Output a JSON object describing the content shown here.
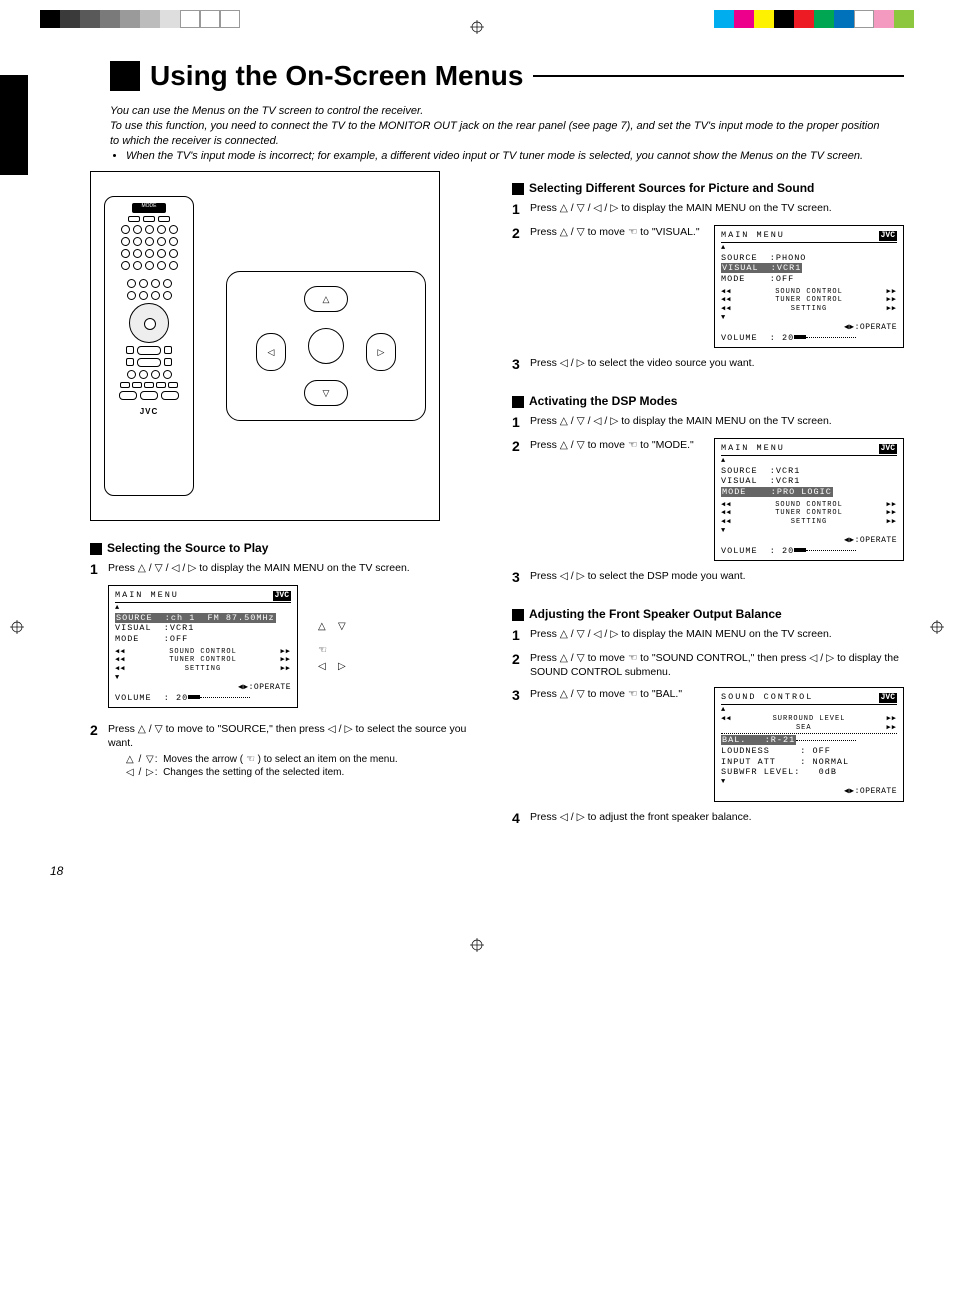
{
  "title": "Using the On-Screen Menus",
  "intro": {
    "p1": "You can use the Menus on the TV screen to control the receiver.",
    "p2": "To use this function, you need to connect the TV to the MONITOR OUT jack on the rear panel (see page 7), and set the TV's input mode to the proper position to which the receiver is connected.",
    "bullet": "When the TV's input mode is incorrect; for example, a different video input or TV tuner mode is selected, you cannot show the Menus on the TV screen."
  },
  "remote_brand": "JVC",
  "left": {
    "heading": "Selecting the Source to Play",
    "step1": {
      "text": "Press △ / ▽ / ◁ / ▷ to display the MAIN MENU on the TV screen."
    },
    "osd": {
      "title": "MAIN MENU",
      "brand": "JVC",
      "source": "SOURCE  :ch 1  FM 87.50MHz",
      "visual": "VISUAL  :VCR1",
      "mode": "MODE    :OFF",
      "l1": "SOUND CONTROL",
      "l2": "TUNER CONTROL",
      "l3": "SETTING",
      "operate": ":OPERATE",
      "volume": "VOLUME  : 20"
    },
    "step2": {
      "main": "Press △ / ▽ to move   to \"SOURCE,\" then press ◁ / ▷ to select the source you want.",
      "sub1": "△ / ▽:  Moves the arrow (  ) to select an item on the menu.",
      "sub2": "◁ / ▷:  Changes the setting of the selected item."
    }
  },
  "right": {
    "sec1": {
      "heading": "Selecting Different Sources for Picture and Sound",
      "step1": "Press △ / ▽ / ◁ / ▷ to display the MAIN MENU on the TV screen.",
      "step2": "Press △ / ▽ to move   to \"VISUAL.\"",
      "step3": "Press ◁ / ▷ to select the video source you want.",
      "osd": {
        "title": "MAIN MENU",
        "brand": "JVC",
        "source": "SOURCE  :PHONO",
        "visual": "VISUAL  :VCR1",
        "mode": "MODE    :OFF",
        "l1": "SOUND CONTROL",
        "l2": "TUNER CONTROL",
        "l3": "SETTING",
        "operate": ":OPERATE",
        "volume": "VOLUME  : 20"
      }
    },
    "sec2": {
      "heading": "Activating the DSP Modes",
      "step1": "Press △ / ▽ / ◁ / ▷ to display the MAIN MENU on the TV screen.",
      "step2": "Press △ / ▽ to move   to \"MODE.\"",
      "step3": "Press ◁ / ▷ to select the DSP mode you want.",
      "osd": {
        "title": "MAIN MENU",
        "brand": "JVC",
        "source": "SOURCE  :VCR1",
        "visual": "VISUAL  :VCR1",
        "mode": "MODE    :PRO LOGIC",
        "l1": "SOUND CONTROL",
        "l2": "TUNER CONTROL",
        "l3": "SETTING",
        "operate": ":OPERATE",
        "volume": "VOLUME  : 20"
      }
    },
    "sec3": {
      "heading": "Adjusting the Front Speaker Output Balance",
      "step1": "Press △ / ▽ / ◁ / ▷ to display the MAIN MENU on the TV screen.",
      "step2": "Press △ / ▽ to move   to \"SOUND CONTROL,\" then press ◁ / ▷ to display the SOUND CONTROL submenu.",
      "step3": "Press △ / ▽ to move   to \"BAL.\"",
      "step4": "Press ◁ / ▷ to adjust the front speaker balance.",
      "osd": {
        "title": "SOUND CONTROL",
        "brand": "JVC",
        "l1": "SURROUND LEVEL",
        "l2": "SEA",
        "bal": "BAL.   :R-21",
        "loud": "LOUDNESS     : OFF",
        "att": "INPUT ATT    : NORMAL",
        "sub": "SUBWFR LEVEL:   0dB",
        "operate": ":OPERATE"
      }
    }
  },
  "page_num": "18",
  "colorbar_left": [
    "#000000",
    "#3a3a3a",
    "#595959",
    "#7a7a7a",
    "#9a9a9a",
    "#bcbcbc",
    "#dedede",
    "#ffffff",
    "#ffffff",
    "#ffffff"
  ],
  "colorbar_right": [
    "#00aeef",
    "#ec008c",
    "#fff200",
    "#000000",
    "#ed1c24",
    "#00a651",
    "#0072bc",
    "#ffffff",
    "#f49ac1",
    "#8dc63f"
  ]
}
